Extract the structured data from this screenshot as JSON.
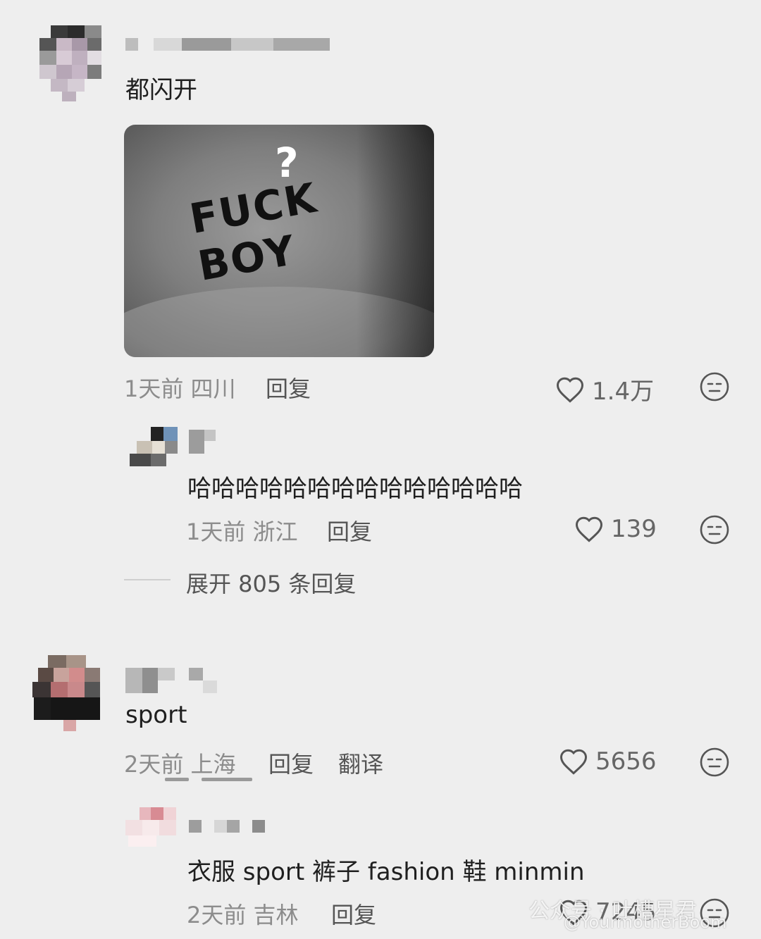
{
  "comments": [
    {
      "text": "都闪开",
      "image_overlay": "?",
      "image_printed_text": "FUCK BOY",
      "meta": "1天前 四川",
      "reply_label": "回复",
      "likes": "1.4万",
      "replies": [
        {
          "text": "哈哈哈哈哈哈哈哈哈哈哈哈哈哈",
          "meta": "1天前 浙江",
          "reply_label": "回复",
          "likes": "139"
        }
      ],
      "expand_label": "展开 805 条回复"
    },
    {
      "text": "sport",
      "meta": "2天前 上海",
      "reply_label": "回复",
      "translate_label": "翻译",
      "likes": "5656",
      "replies": [
        {
          "text": "衣服 sport  裤子 fashion  鞋 minmin",
          "meta": "2天前 吉林",
          "reply_label": "回复",
          "likes": "7245"
        }
      ]
    }
  ],
  "watermark": {
    "text": "公众号 · 吐槽星君",
    "sub": "@YourmotherBoom"
  },
  "icons": {
    "like": "heart-icon",
    "dislike": "neutral-face-icon"
  },
  "colors": {
    "background": "#eeeeee",
    "text": "#1f1f1f",
    "meta": "#8c8c8c"
  }
}
